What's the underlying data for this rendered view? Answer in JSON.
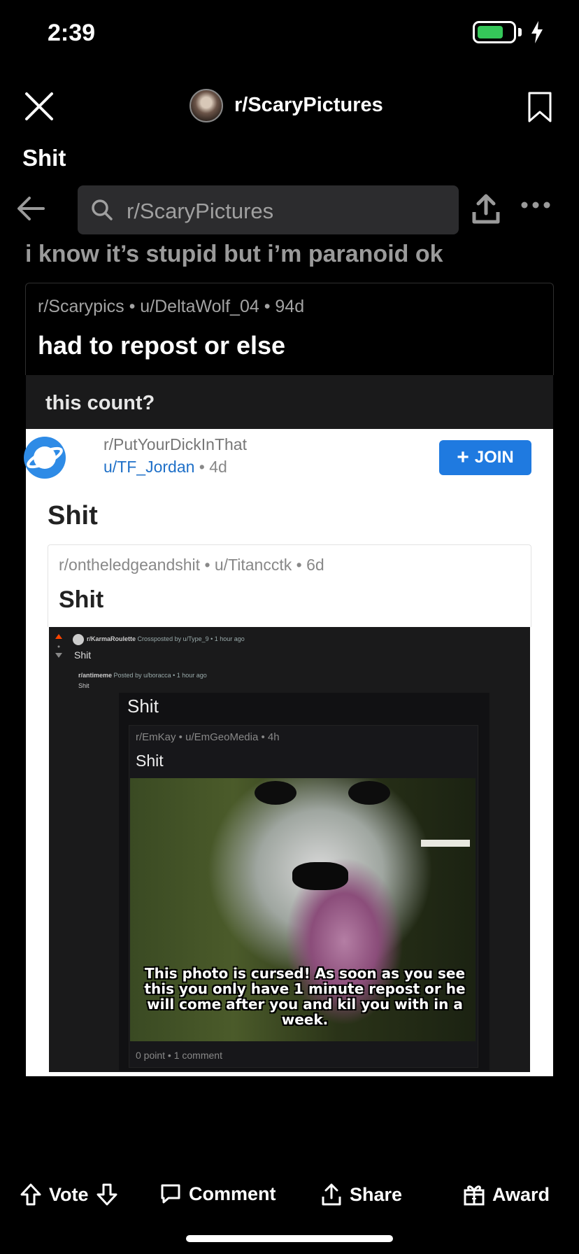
{
  "status_bar": {
    "time": "2:39"
  },
  "header": {
    "subreddit": "r/ScaryPictures",
    "post_title": "Shit"
  },
  "screenshot": {
    "search_placeholder": "r/ScaryPictures",
    "headline": "i know it’s stupid but i’m paranoid ok",
    "crosspost": {
      "meta": "r/Scarypics • u/DeltaWolf_04 • 94d",
      "title": "had to repost or else"
    },
    "image": {
      "dark_caption": "this count?",
      "white_sub": "r/PutYourDickInThat",
      "white_user": "u/TF_Jordan",
      "white_time": " • 4d",
      "join_label": "JOIN",
      "white_title": "Shit",
      "inner_meta": "r/ontheledgeandshit • u/Titancctk • 6d",
      "inner_title": "Shit",
      "tiny_sub": "r/KarmaRoulette",
      "tiny_meta": "Crossposted by u/Type_9 • 1 hour ago",
      "tiny_title": "Shit",
      "tiny_sub2": "r/antimeme",
      "tiny_meta2": "Posted by u/boracca • 1 hour ago",
      "tiny_title2": "Shit",
      "inner2_title": "Shit",
      "inner3_meta": "r/EmKay • u/EmGeoMedia • 4h",
      "inner3_title": "Shit",
      "photo_caption": "This photo is cursed! As soon as you see this you only have 1 minute repost or he will come after you and kil you with in a week.",
      "points": "0 point • 1 comment"
    }
  },
  "bottom_bar": {
    "vote": "Vote",
    "comment": "Comment",
    "share": "Share",
    "award": "Award"
  },
  "colors": {
    "join": "#1f7ae0",
    "battery": "#35c759"
  }
}
